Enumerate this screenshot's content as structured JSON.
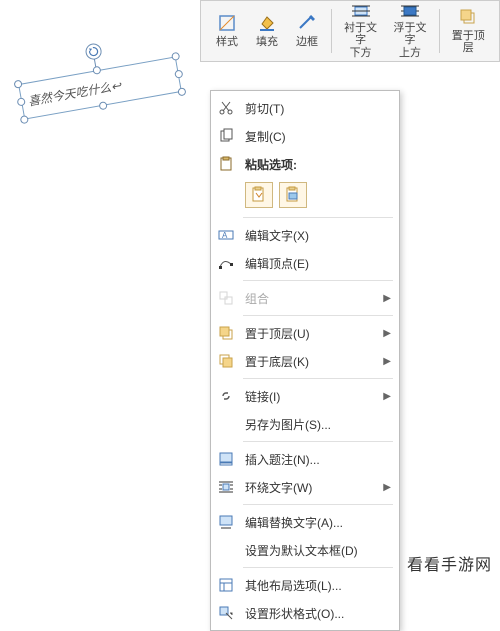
{
  "toolbar": {
    "style": "样式",
    "fill": "填充",
    "border": "边框",
    "behind_text": "衬于文字\n下方",
    "above_text": "浮于文字\n上方",
    "bring_front": "置于顶层"
  },
  "shape": {
    "text": "喜然今天吃什么↩"
  },
  "menu": {
    "cut": "剪切(T)",
    "copy": "复制(C)",
    "paste_options": "粘贴选项:",
    "edit_text": "编辑文字(X)",
    "edit_vertex": "编辑顶点(E)",
    "group": "组合",
    "bring_front": "置于顶层(U)",
    "send_back": "置于底层(K)",
    "link": "链接(I)",
    "save_as_picture": "另存为图片(S)...",
    "insert_caption": "插入题注(N)...",
    "wrap_text": "环绕文字(W)",
    "alt_text": "编辑替换文字(A)...",
    "set_default_textbox": "设置为默认文本框(D)",
    "more_layout": "其他布局选项(L)...",
    "format_shape": "设置形状格式(O)..."
  },
  "watermark": "看看手游网"
}
